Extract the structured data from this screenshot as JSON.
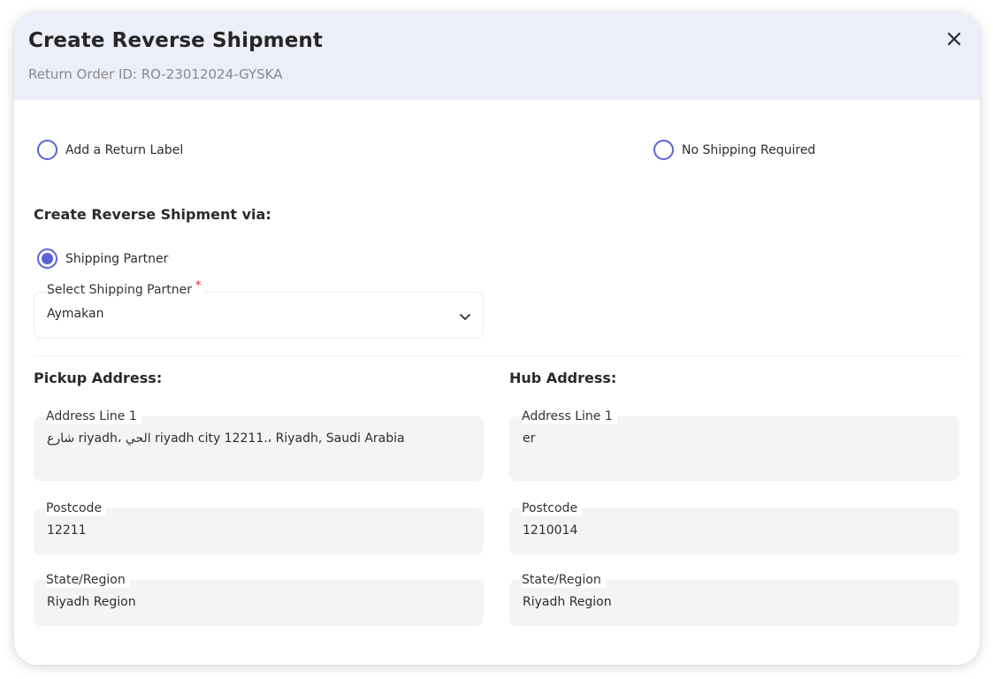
{
  "header": {
    "title": "Create Reverse Shipment",
    "subtitle": "Return Order ID: RO-23012024-GYSKA",
    "close_icon": "close-icon"
  },
  "options": {
    "add_return_label": "Add a Return Label",
    "add_return_label_checked": false,
    "no_shipping_required": "No Shipping Required",
    "no_shipping_required_checked": false
  },
  "via": {
    "heading": "Create Reverse Shipment via:",
    "shipping_partner_label": "Shipping Partner",
    "shipping_partner_checked": true,
    "select_label": "Select Shipping Partner",
    "required_marker": "*",
    "selected_value": "Aymakan"
  },
  "pickup": {
    "heading": "Pickup Address:",
    "address_line_1_label": "Address Line 1",
    "address_line_1": "شارع riyadh، الحي riyadh city 12211.، Riyadh, Saudi Arabia",
    "postcode_label": "Postcode",
    "postcode": "12211",
    "state_label": "State/Region",
    "state": "Riyadh Region"
  },
  "hub": {
    "heading": "Hub Address:",
    "address_line_1_label": "Address Line 1",
    "address_line_1": "er",
    "postcode_label": "Postcode",
    "postcode": "1210014",
    "state_label": "State/Region",
    "state": "Riyadh Region"
  },
  "colors": {
    "accent": "#5b63d9",
    "header_bg": "#eceefa",
    "field_bg": "#f4f4f4",
    "required": "#e02424"
  }
}
